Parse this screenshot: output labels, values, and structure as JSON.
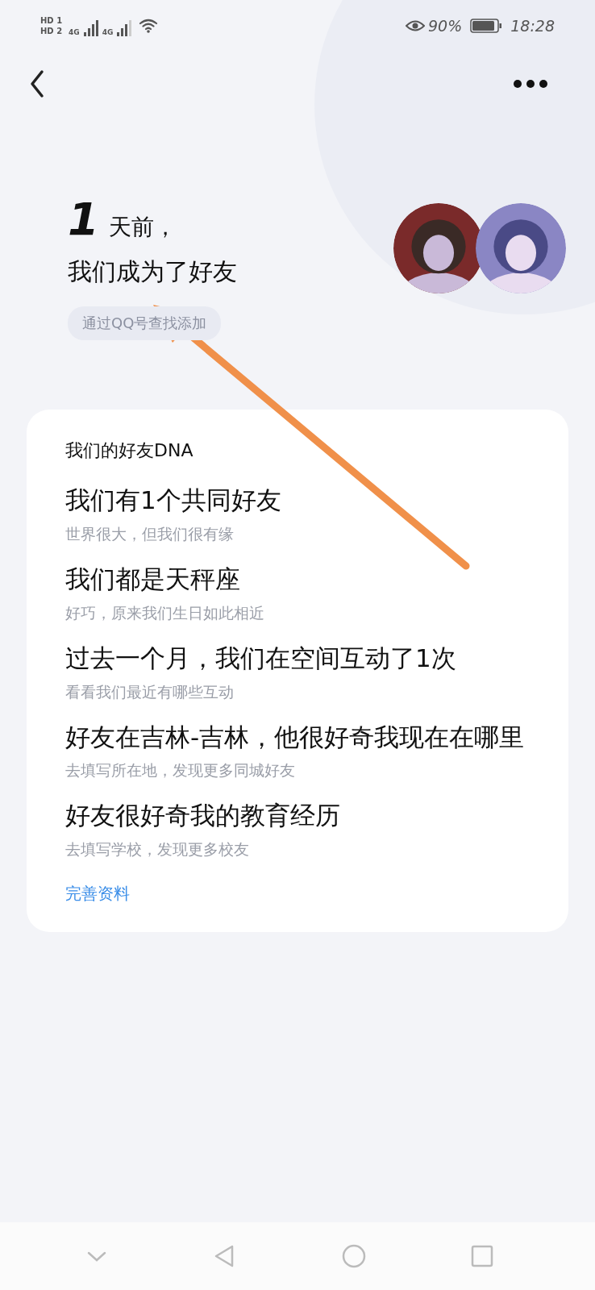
{
  "status_bar": {
    "sims": [
      {
        "hd": "HD",
        "slot": "1",
        "network": "4G"
      },
      {
        "hd": "HD",
        "slot": "2",
        "network": "4G"
      }
    ],
    "battery": "90%",
    "time": "18:28"
  },
  "header": {
    "days": "1",
    "days_suffix": "天前，",
    "subtitle": "我们成为了好友",
    "source_tag": "通过QQ号查找添加"
  },
  "card": {
    "title": "我们的好友DNA",
    "items": [
      {
        "title": "我们有1个共同好友",
        "subtitle": "世界很大，但我们很有缘"
      },
      {
        "title": "我们都是天秤座",
        "subtitle": "好巧，原来我们生日如此相近"
      },
      {
        "title": "过去一个月，我们在空间互动了1次",
        "subtitle": "看看我们最近有哪些互动"
      },
      {
        "title": "好友在吉林-吉林，他很好奇我现在在哪里",
        "subtitle": "去填写所在地，发现更多同城好友"
      },
      {
        "title": "好友很好奇我的教育经历",
        "subtitle": "去填写学校，发现更多校友"
      }
    ],
    "link": "完善资料"
  }
}
